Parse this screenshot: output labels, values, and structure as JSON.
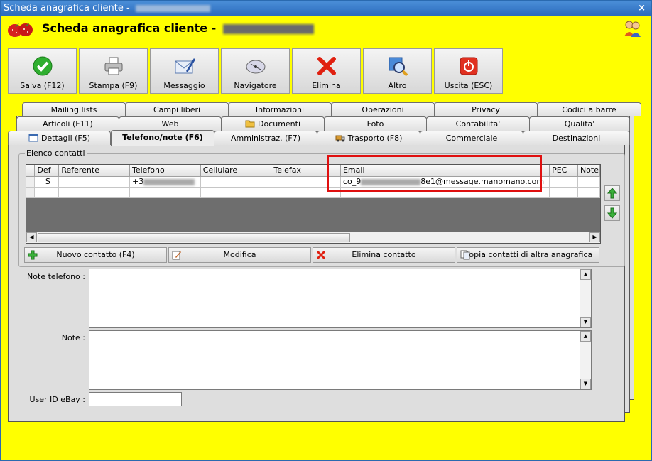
{
  "window": {
    "title": "Scheda anagrafica cliente - ",
    "header_title": "Scheda anagrafica cliente - "
  },
  "toolbar": [
    {
      "label": "Salva (F12)",
      "icon": "check-icon"
    },
    {
      "label": "Stampa (F9)",
      "icon": "printer-icon"
    },
    {
      "label": "Messaggio",
      "icon": "envelope-pen-icon"
    },
    {
      "label": "Navigatore",
      "icon": "compass-icon"
    },
    {
      "label": "Elimina",
      "icon": "red-x-icon"
    },
    {
      "label": "Altro",
      "icon": "magnifier-icon"
    },
    {
      "label": "Uscita (ESC)",
      "icon": "power-icon"
    }
  ],
  "tabs": {
    "row1": [
      "Mailing lists",
      "Campi liberi",
      "Informazioni",
      "Operazioni",
      "Privacy",
      "Codici a barre"
    ],
    "row2": [
      "Articoli (F11)",
      "Web",
      "Documenti",
      "Foto",
      "Contabilita'",
      "Qualita'"
    ],
    "row3": [
      "Dettagli (F5)",
      "Telefono/note (F6)",
      "Amministraz. (F7)",
      "Trasporto (F8)",
      "Commerciale",
      "Destinazioni"
    ]
  },
  "contacts": {
    "group_title": "Elenco contatti",
    "columns": [
      "Def",
      "Referente",
      "Telefono",
      "Cellulare",
      "Telefax",
      "Email",
      "PEC",
      "Note"
    ],
    "rows": [
      {
        "def": "S",
        "referente": "",
        "telefono": "+3",
        "cellulare": "",
        "telefax": "",
        "email_prefix": "co_9",
        "email_suffix": "8e1@message.manomano.com",
        "pec": "",
        "note": ""
      }
    ],
    "buttons": {
      "new": "Nuovo contatto (F4)",
      "edit": "Modifica",
      "delete": "Elimina contatto",
      "copy": "Copia contatti di altra anagrafica"
    }
  },
  "fields": {
    "note_telefono_label": "Note telefono :",
    "note_label": "Note :",
    "ebay_label": "User ID eBay :",
    "ebay_value": ""
  },
  "colors": {
    "background": "#ffff00",
    "titlebar": "#2c6bbd",
    "highlight": "#e01010"
  }
}
